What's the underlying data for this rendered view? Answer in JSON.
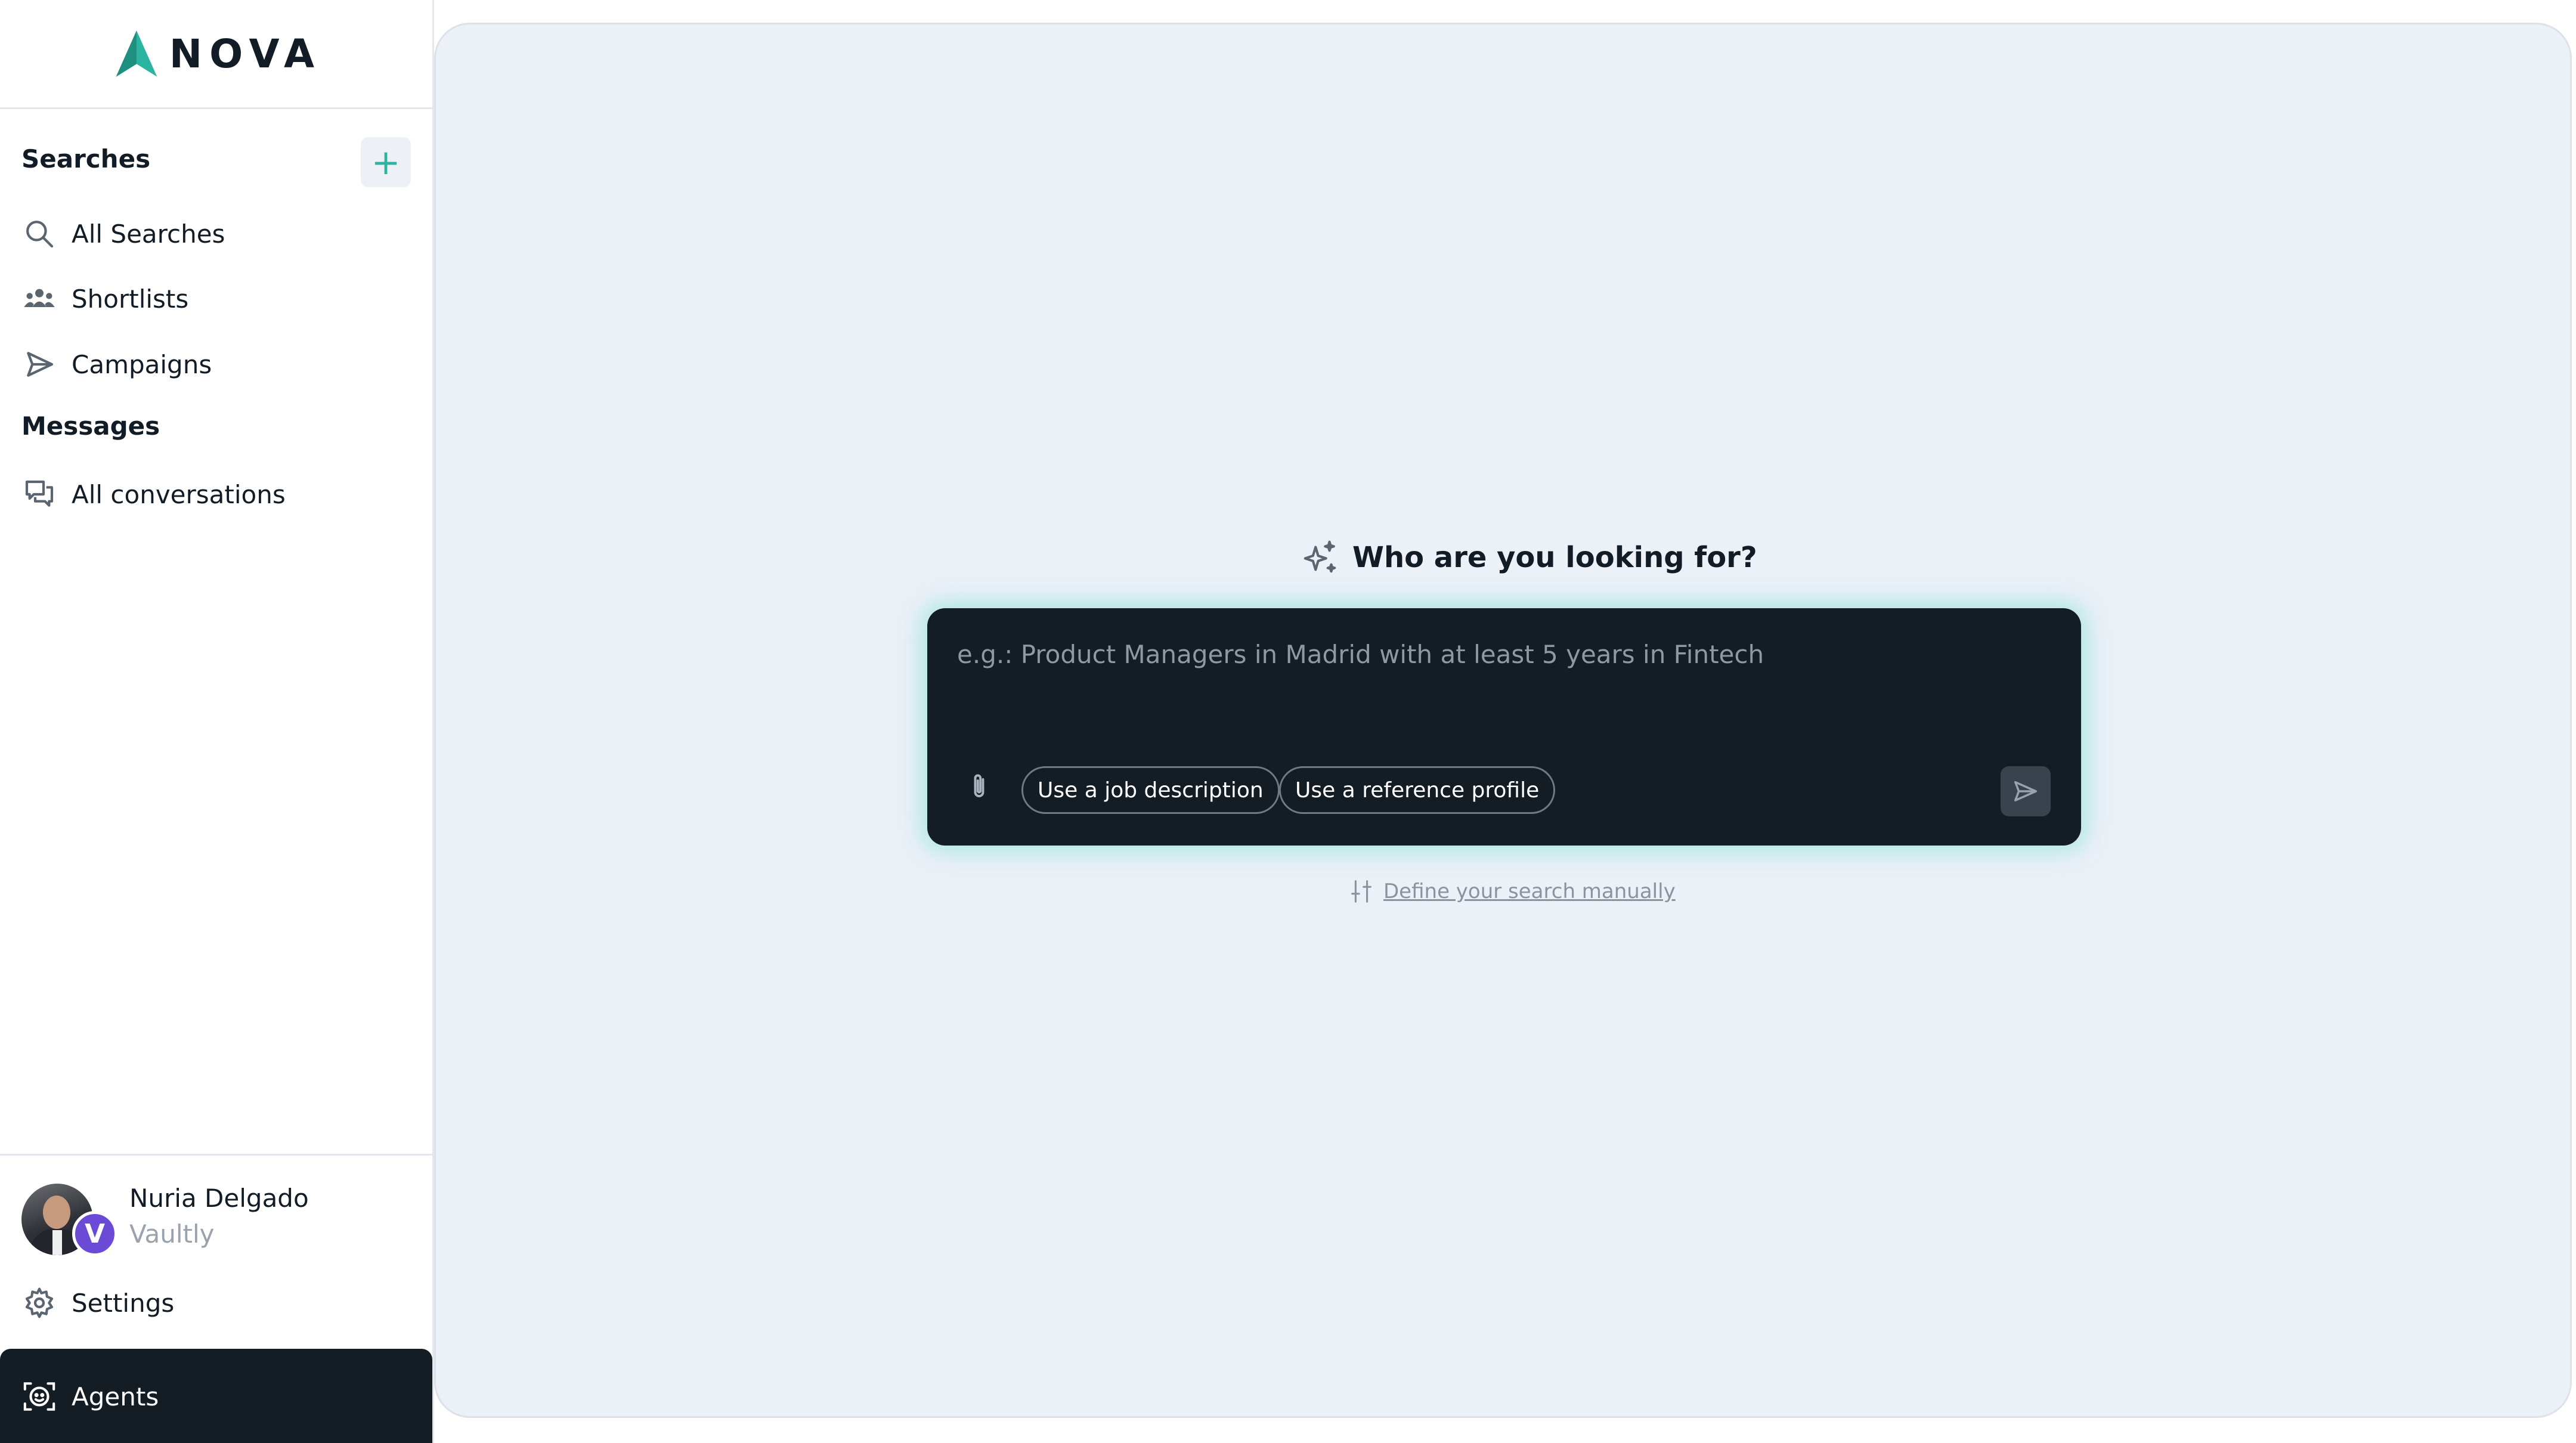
{
  "brand": {
    "name": "NOVA",
    "accent": "#2bb5a0"
  },
  "sidebar": {
    "searches_title": "Searches",
    "add_icon": "plus-icon",
    "search_items": [
      {
        "label": "All Searches",
        "icon": "search-icon"
      },
      {
        "label": "Shortlists",
        "icon": "people-icon"
      },
      {
        "label": "Campaigns",
        "icon": "send-outline-icon"
      }
    ],
    "messages_title": "Messages",
    "message_items": [
      {
        "label": "All conversations",
        "icon": "chat-icon"
      }
    ],
    "user": {
      "name": "Nuria Delgado",
      "org": "Vaultly",
      "org_badge": "V"
    },
    "settings_label": "Settings",
    "agents_label": "Agents"
  },
  "main": {
    "prompt_title": "Who are you looking for?",
    "input_placeholder": "e.g.: Product Managers in Madrid with at least 5 years in Fintech",
    "chips": [
      "Use a job description",
      "Use a reference profile"
    ],
    "manual_link": "Define your search manually"
  }
}
